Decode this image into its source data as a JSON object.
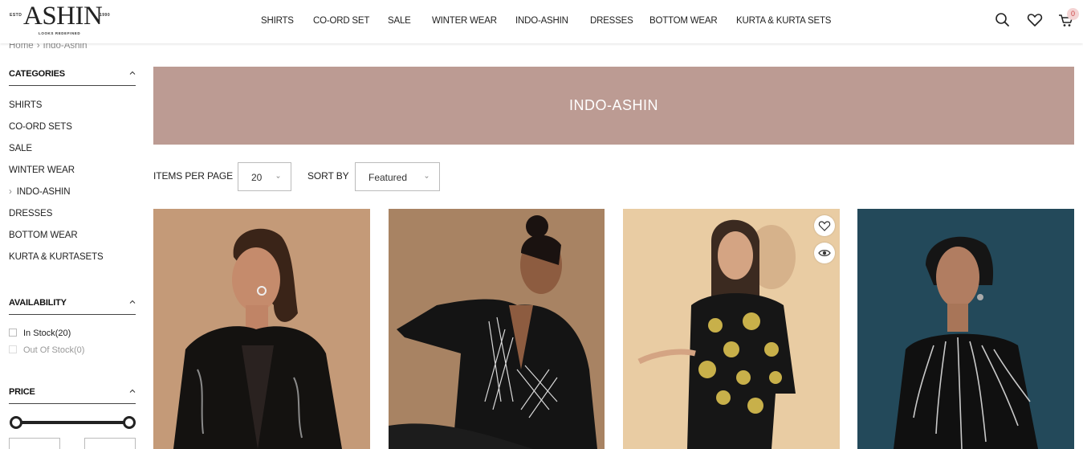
{
  "header": {
    "logo": {
      "estd": "ESTD",
      "brand": "ASHIN",
      "year": "1990",
      "tagline": "LOOKS REDEFINED"
    },
    "nav": [
      {
        "label": "SHIRTS"
      },
      {
        "label": "CO-ORD SET"
      },
      {
        "label": "SALE"
      },
      {
        "label": "WINTER WEAR"
      },
      {
        "label": "INDO-ASHIN"
      },
      {
        "label": "DRESSES"
      },
      {
        "label": "BOTTOM WEAR"
      },
      {
        "label": "KURTA & KURTA SETS"
      }
    ],
    "icons": [
      "search-icon",
      "heart-icon",
      "cart-icon"
    ],
    "cart_count": "0"
  },
  "breadcrumb": {
    "home": "Home",
    "separator": "›",
    "current": "Indo-Ashin"
  },
  "sidebar": {
    "categories_title": "CATEGORIES",
    "categories": [
      "SHIRTS",
      "CO-ORD SETS",
      "SALE",
      "WINTER WEAR",
      "INDO-ASHIN",
      "DRESSES",
      "BOTTOM WEAR",
      "KURTA & KURTASETS"
    ],
    "active_category": "INDO-ASHIN",
    "availability_title": "AVAILABILITY",
    "availability": [
      {
        "label": "In Stock(20)",
        "enabled": true
      },
      {
        "label": "Out Of Stock(0)",
        "enabled": false
      }
    ],
    "price_title": "PRICE"
  },
  "banner": {
    "title": "INDO-ASHIN",
    "color": "#bc9b93"
  },
  "toolbar": {
    "items_per_page_label": "ITEMS PER PAGE",
    "items_per_page_value": "20",
    "sort_label": "SORT BY",
    "sort_value": "Featured"
  },
  "products": [
    {
      "image": "woman-black-blazer-embroidered"
    },
    {
      "image": "woman-black-blazer-checked"
    },
    {
      "image": "woman-black-gold-floral-cape"
    },
    {
      "image": "woman-black-embellished-kurta"
    }
  ],
  "product_hover_icons": [
    "heart-icon",
    "eye-icon"
  ]
}
